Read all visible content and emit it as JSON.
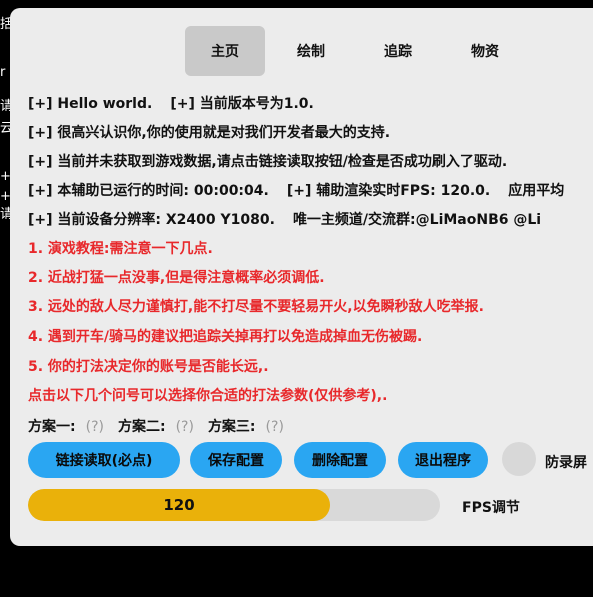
{
  "background_chars": [
    "括",
    "r",
    "请",
    "云",
    "+",
    "+",
    "请"
  ],
  "tabs": [
    {
      "label": "主页",
      "active": true
    },
    {
      "label": "绘制",
      "active": false
    },
    {
      "label": "追踪",
      "active": false
    },
    {
      "label": "物资",
      "active": false
    }
  ],
  "info": {
    "hello": "[+] Hello world.",
    "version": "[+] 当前版本号为1.0.",
    "welcome": "[+] 很高兴认识你,你的使用就是对我们开发者最大的支持.",
    "no_data": "[+] 当前并未获取到游戏数据,请点击链接读取按钮/检查是否成功刷入了驱动.",
    "runtime": "[+] 本辅助已运行的时间: 00:00:04.",
    "fps": "[+] 辅助渲染实时FPS: 120.0.",
    "platform": "应用平均",
    "resolution": "[+] 当前设备分辨率: X2400 Y1080.",
    "channel": "唯一主频道/交流群:@LiMaoNB6 @Li"
  },
  "tips": [
    "1. 演戏教程:需注意一下几点.",
    "2. 近战打猛一点没事,但是得注意概率必须调低.",
    "3. 远处的敌人尽力谨慎打,能不打尽量不要轻易开火,以免瞬秒敌人吃举报.",
    "4. 遇到开车/骑马的建议把追踪关掉再打以免造成掉血无伤被踢.",
    "5. 你的打法决定你的账号是否能长远,.",
    "点击以下几个问号可以选择你合适的打法参数(仅供参考),."
  ],
  "plans": [
    {
      "label": "方案一:",
      "q": "(?)"
    },
    {
      "label": "方案二:",
      "q": "(?)"
    },
    {
      "label": "方案三:",
      "q": "(?)"
    }
  ],
  "buttons": {
    "connect": "链接读取(必点)",
    "save": "保存配置",
    "delete": "删除配置",
    "exit": "退出程序"
  },
  "toggle": {
    "label": "防录屏",
    "on": false
  },
  "fps_slider": {
    "value": "120",
    "label": "FPS调节",
    "fill_fraction": 0.733
  },
  "colors": {
    "accent_button": "#2aa6f2",
    "slider_fill": "#eab10a",
    "tip_text": "#e8282b",
    "panel_bg": "#ececec"
  }
}
